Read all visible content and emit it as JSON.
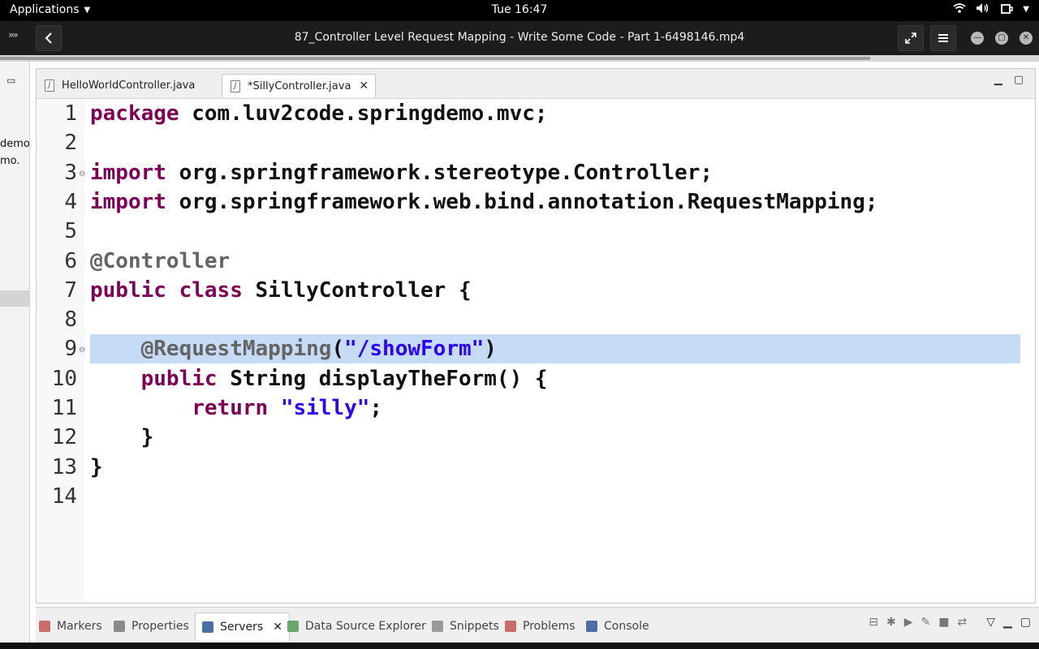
{
  "system_bar": {
    "applications_label": "Applications",
    "clock": "Tue 16:47"
  },
  "window": {
    "title": "87_Controller Level Request Mapping - Write Some Code - Part 1-6498146.mp4"
  },
  "left_panel": {
    "fragments": [
      "demo",
      "mo."
    ]
  },
  "editor": {
    "tabs": [
      {
        "label": "HelloWorldController.java",
        "active": false
      },
      {
        "label": "*SillyController.java",
        "active": true
      }
    ],
    "lines": [
      {
        "n": "1",
        "tokens": [
          {
            "t": "package",
            "c": "kw"
          },
          {
            "t": " com.luv2code.springdemo.mvc;",
            "c": ""
          }
        ]
      },
      {
        "n": "2",
        "tokens": []
      },
      {
        "n": "3",
        "fold": true,
        "tokens": [
          {
            "t": "import",
            "c": "kw"
          },
          {
            "t": " org.springframework.stereotype.Controller;",
            "c": ""
          }
        ]
      },
      {
        "n": "4",
        "tokens": [
          {
            "t": "import",
            "c": "kw"
          },
          {
            "t": " org.springframework.web.bind.annotation.RequestMapping;",
            "c": ""
          }
        ]
      },
      {
        "n": "5",
        "tokens": []
      },
      {
        "n": "6",
        "tokens": [
          {
            "t": "@Controller",
            "c": "ann"
          }
        ]
      },
      {
        "n": "7",
        "tokens": [
          {
            "t": "public",
            "c": "kw"
          },
          {
            "t": " ",
            "c": ""
          },
          {
            "t": "class",
            "c": "kw"
          },
          {
            "t": " SillyController {",
            "c": ""
          }
        ]
      },
      {
        "n": "8",
        "tokens": []
      },
      {
        "n": "9",
        "fold": true,
        "highlight": true,
        "tokens": [
          {
            "t": "    ",
            "c": ""
          },
          {
            "t": "@RequestMapping",
            "c": "ann"
          },
          {
            "t": "(",
            "c": ""
          },
          {
            "t": "\"/showForm\"",
            "c": "str"
          },
          {
            "t": ")",
            "c": ""
          }
        ]
      },
      {
        "n": "10",
        "tokens": [
          {
            "t": "    ",
            "c": ""
          },
          {
            "t": "public",
            "c": "kw"
          },
          {
            "t": " String displayTheForm() {",
            "c": ""
          }
        ]
      },
      {
        "n": "11",
        "tokens": [
          {
            "t": "        ",
            "c": ""
          },
          {
            "t": "return",
            "c": "kw"
          },
          {
            "t": " ",
            "c": ""
          },
          {
            "t": "\"silly\"",
            "c": "str"
          },
          {
            "t": ";",
            "c": ""
          }
        ]
      },
      {
        "n": "12",
        "tokens": [
          {
            "t": "    }",
            "c": ""
          }
        ]
      },
      {
        "n": "13",
        "tokens": [
          {
            "t": "}",
            "c": ""
          }
        ]
      },
      {
        "n": "14",
        "tokens": []
      }
    ]
  },
  "bottom_panel": {
    "tabs": [
      {
        "label": "Markers",
        "icon": "markers-icon",
        "color": "#c86b6b"
      },
      {
        "label": "Properties",
        "icon": "properties-icon",
        "color": "#8a8a8a"
      },
      {
        "label": "Servers",
        "icon": "servers-icon",
        "color": "#4a6fa5",
        "active": true
      },
      {
        "label": "Data Source Explorer",
        "icon": "data-source-icon",
        "color": "#6aa56a"
      },
      {
        "label": "Snippets",
        "icon": "snippets-icon",
        "color": "#9a9a9a"
      },
      {
        "label": "Problems",
        "icon": "problems-icon",
        "color": "#c86b6b"
      },
      {
        "label": "Console",
        "icon": "console-icon",
        "color": "#4a6fa5"
      }
    ]
  }
}
